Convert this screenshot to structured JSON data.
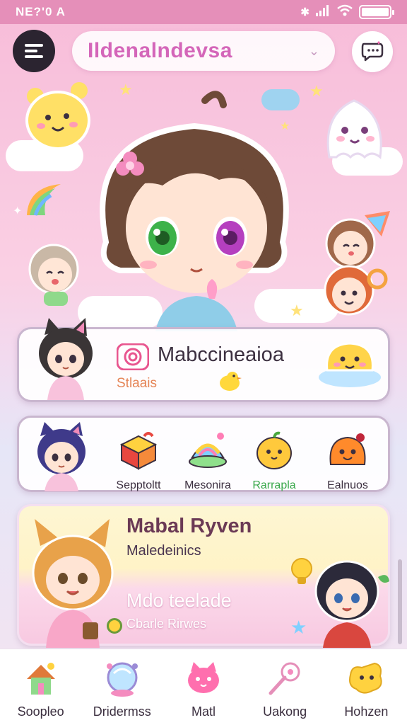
{
  "status_bar": {
    "time": "NE?'0 A",
    "battery_level": 0.9
  },
  "header": {
    "title": "Ildenalndevsa",
    "menu_icon": "menu-icon",
    "chat_icon": "chat-bubble-icon"
  },
  "featured_card": {
    "title": "Mabccineaioa",
    "subtitle": "Stlaais"
  },
  "categories": [
    {
      "label": "Sepptoltt",
      "icon": "box-icon"
    },
    {
      "label": "Mesonira",
      "icon": "rainbow-hat-icon"
    },
    {
      "label": "Rarrapla",
      "icon": "fruit-icon"
    },
    {
      "label": "Ealnuos",
      "icon": "jelly-icon"
    }
  ],
  "profile_card": {
    "name": "Mabal Ryven",
    "subtitle": "Maledeinics",
    "secondary_name": "Mdo teelade",
    "secondary_subtitle": "Cbarle Rirwes"
  },
  "bottom_nav": [
    {
      "label": "Soopleo",
      "icon": "house-icon"
    },
    {
      "label": "Dridermss",
      "icon": "crystal-ball-icon"
    },
    {
      "label": "Matl",
      "icon": "cat-blob-icon"
    },
    {
      "label": "Uakong",
      "icon": "wand-icon"
    },
    {
      "label": "Hohzen",
      "icon": "star-blob-icon"
    }
  ],
  "colors": {
    "accent": "#d466b9",
    "status_bar": "#e58fb9",
    "dark_button": "#2b2430"
  }
}
